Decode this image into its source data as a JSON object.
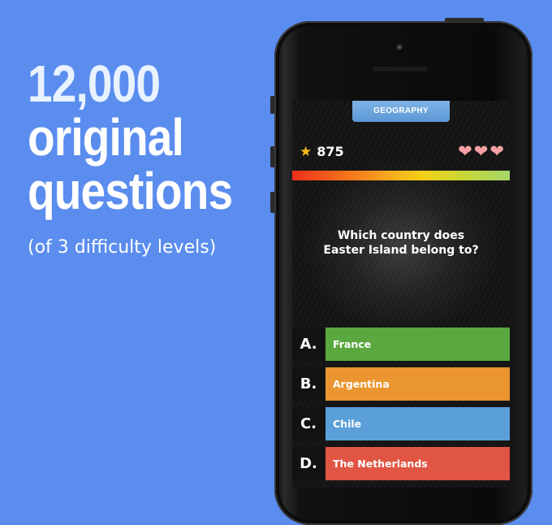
{
  "promo": {
    "line1": "12,000",
    "line2": "original",
    "line3": "questions",
    "subline": "(of 3 difficulty levels)"
  },
  "game": {
    "category": "GEOGRAPHY",
    "score": "875",
    "lives": 3,
    "question_line1": "Which country does",
    "question_line2": "Easter Island belong to?",
    "answers": [
      {
        "letter": "A.",
        "text": "France",
        "color": "#5aa83f"
      },
      {
        "letter": "B.",
        "text": "Argentina",
        "color": "#ea952f"
      },
      {
        "letter": "C.",
        "text": "Chile",
        "color": "#5a9fd8"
      },
      {
        "letter": "D.",
        "text": "The Netherlands",
        "color": "#e05544"
      }
    ]
  },
  "colors": {
    "background": "#5b8def",
    "tab": "#6aa4dd",
    "star": "#f6b916",
    "heart": "#f4a0a4"
  },
  "icons": {
    "star": "star-icon",
    "heart": "heart-icon"
  }
}
